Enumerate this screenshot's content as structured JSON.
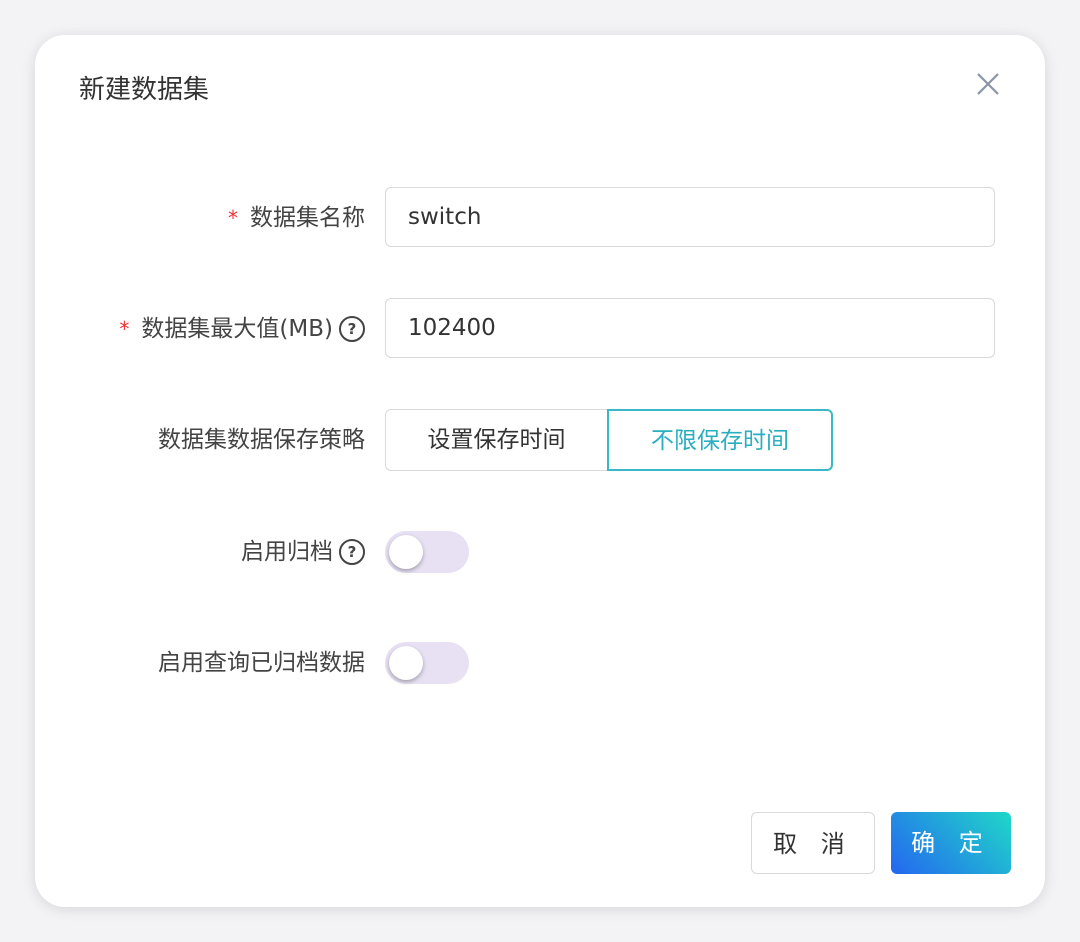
{
  "dialog": {
    "title": "新建数据集",
    "fields": {
      "name": {
        "label": "数据集名称",
        "required": "*",
        "value": "switch"
      },
      "max_size": {
        "label": "数据集最大值(MB)",
        "required": "*",
        "value": "102400",
        "help": "?"
      },
      "retention": {
        "label": "数据集数据保存策略",
        "options": [
          "设置保存时间",
          "不限保存时间"
        ],
        "selected": "不限保存时间"
      },
      "archive": {
        "label": "启用归档",
        "help": "?",
        "enabled": false
      },
      "query_archived": {
        "label": "启用查询已归档数据",
        "enabled": false
      }
    },
    "buttons": {
      "cancel": "取 消",
      "ok": "确 定"
    },
    "colors": {
      "accent": "#3bb8c8",
      "primary_gradient_start": "#2466f0",
      "primary_gradient_end": "#20d8c8",
      "switch_off": "#e7e1f3",
      "required": "#e33333"
    }
  }
}
